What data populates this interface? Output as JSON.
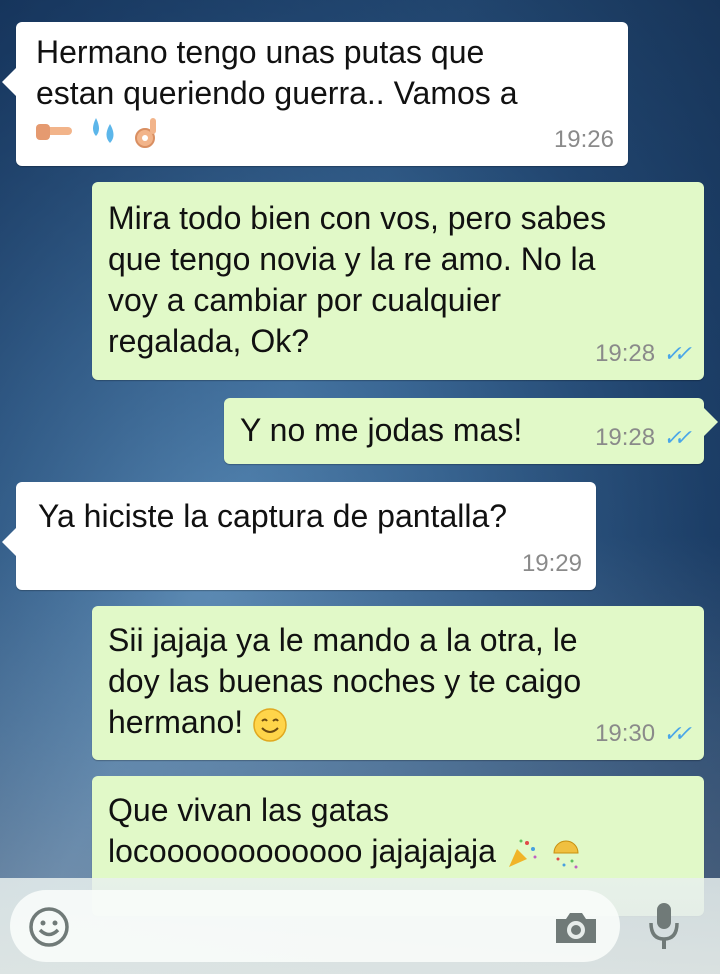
{
  "messages": [
    {
      "direction": "in",
      "lines": [
        "Hermano tengo unas putas que",
        "estan queriendo guerra.. Vamos a"
      ],
      "emojis": [
        "pointing-hand-emoji",
        "droplets-emoji",
        "ok-hand-emoji"
      ],
      "time": "19:26"
    },
    {
      "direction": "out",
      "lines": [
        "Mira todo bien con vos, pero sabes",
        "que tengo novia y la re amo. No la",
        "voy a cambiar por cualquier",
        "regalada, Ok?"
      ],
      "time": "19:28",
      "status": "read"
    },
    {
      "direction": "out",
      "lines": [
        "Y no me jodas mas!"
      ],
      "time": "19:28",
      "status": "read"
    },
    {
      "direction": "in",
      "lines": [
        "Ya hiciste la captura de pantalla?"
      ],
      "time": "19:29"
    },
    {
      "direction": "out",
      "lines": [
        "Sii jajaja ya le mando a la otra, le",
        "doy las buenas noches y te caigo",
        "hermano!"
      ],
      "emojis": [
        "smiling-face-emoji"
      ],
      "time": "19:30",
      "status": "read"
    },
    {
      "direction": "out",
      "lines": [
        "Que vivan las gatas",
        "locoooooooooooo jajajajaja"
      ],
      "emojis": [
        "party-popper-emoji",
        "confetti-ball-emoji"
      ]
    }
  ],
  "composer": {
    "emoji_icon": "smiley-icon",
    "camera_icon": "camera-icon",
    "mic_icon": "microphone-icon"
  },
  "colors": {
    "incoming": "#ffffff",
    "outgoing": "#e1f9c8",
    "read_ticks": "#4aa6e8",
    "timestamp": "#8a8a8a"
  }
}
